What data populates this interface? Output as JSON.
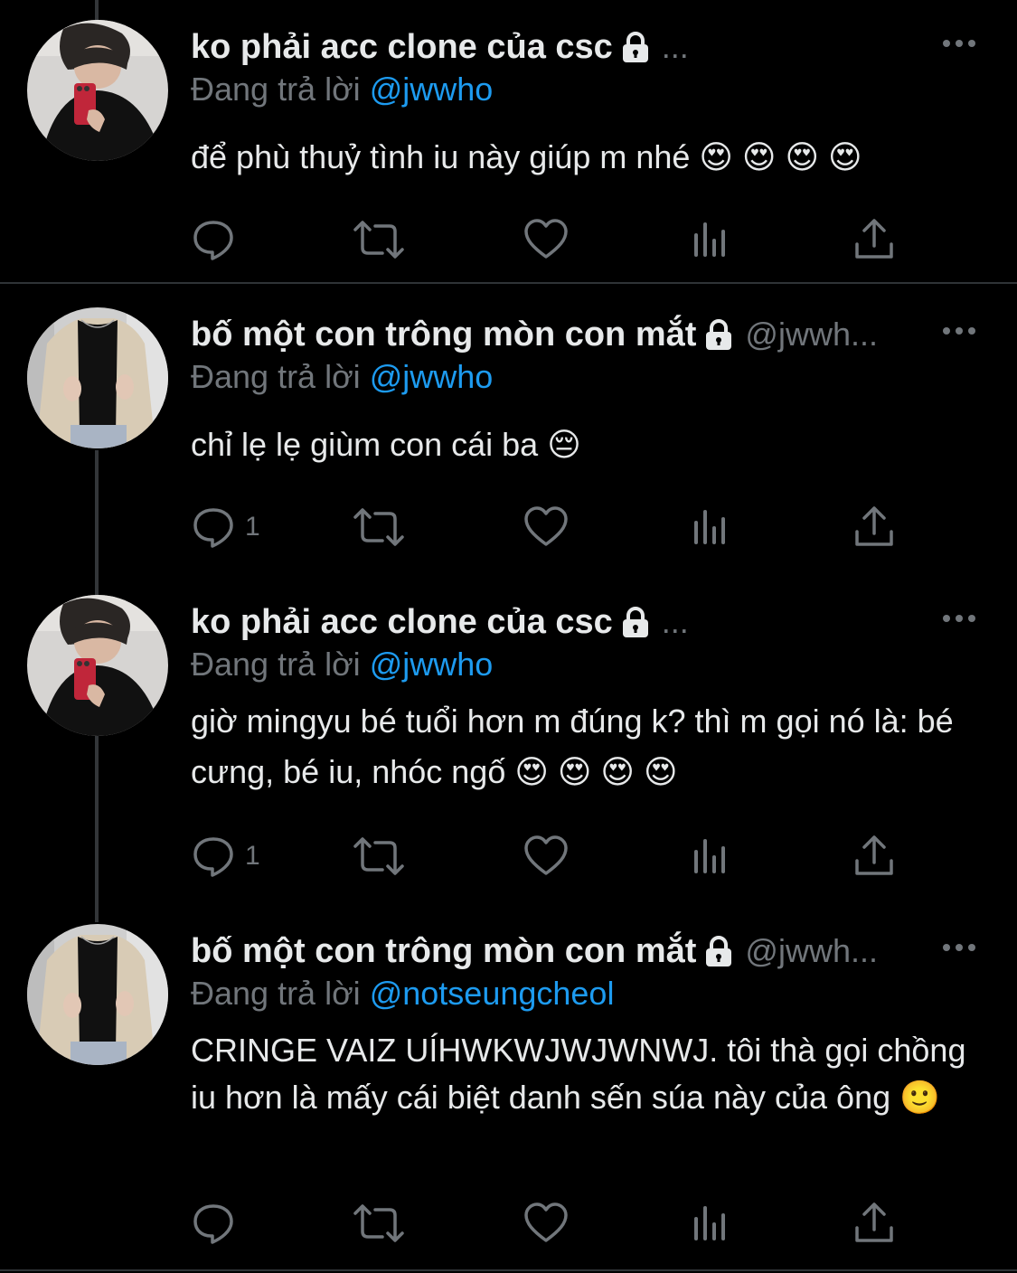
{
  "tweets": [
    {
      "name": "ko phải acc clone của csc",
      "handle": "...",
      "reply_label": "Đang trả lời",
      "reply_to": "@jwwho",
      "text": "để phù thuỷ tình iu này giúp m nhé 😍 😍 😍 😍",
      "reply_count": ""
    },
    {
      "name": "bố một con trông mòn con mắt",
      "handle": "@jwwh...",
      "reply_label": "Đang trả lời",
      "reply_to": "@jwwho",
      "text": "chỉ lẹ lẹ giùm con cái ba 😔",
      "reply_count": "1"
    },
    {
      "name": "ko phải acc clone của csc",
      "handle": "...",
      "reply_label": "Đang trả lời",
      "reply_to": "@jwwho",
      "text": "giờ mingyu bé tuổi hơn m đúng k? thì m gọi nó là: bé cưng, bé iu, nhóc ngố 😍 😍 😍 😍",
      "reply_count": "1"
    },
    {
      "name": "bố một con trông mòn con mắt",
      "handle": "@jwwh...",
      "reply_label": "Đang trả lời",
      "reply_to": "@notseungcheol",
      "text": "CRINGE VAIZ UÍHWKWJWJWNWJ. tôi thà gọi chồng iu hơn là mấy cái biệt danh sến súa này của ông 🙂",
      "reply_count": ""
    }
  ],
  "icons": [
    "lock-icon",
    "more-icon",
    "reply-icon",
    "retweet-icon",
    "like-icon",
    "views-icon",
    "share-icon"
  ],
  "colors": {
    "background": "#000000",
    "text": "#e7e9ea",
    "muted": "#71767b",
    "accent": "#1d9bf0"
  }
}
